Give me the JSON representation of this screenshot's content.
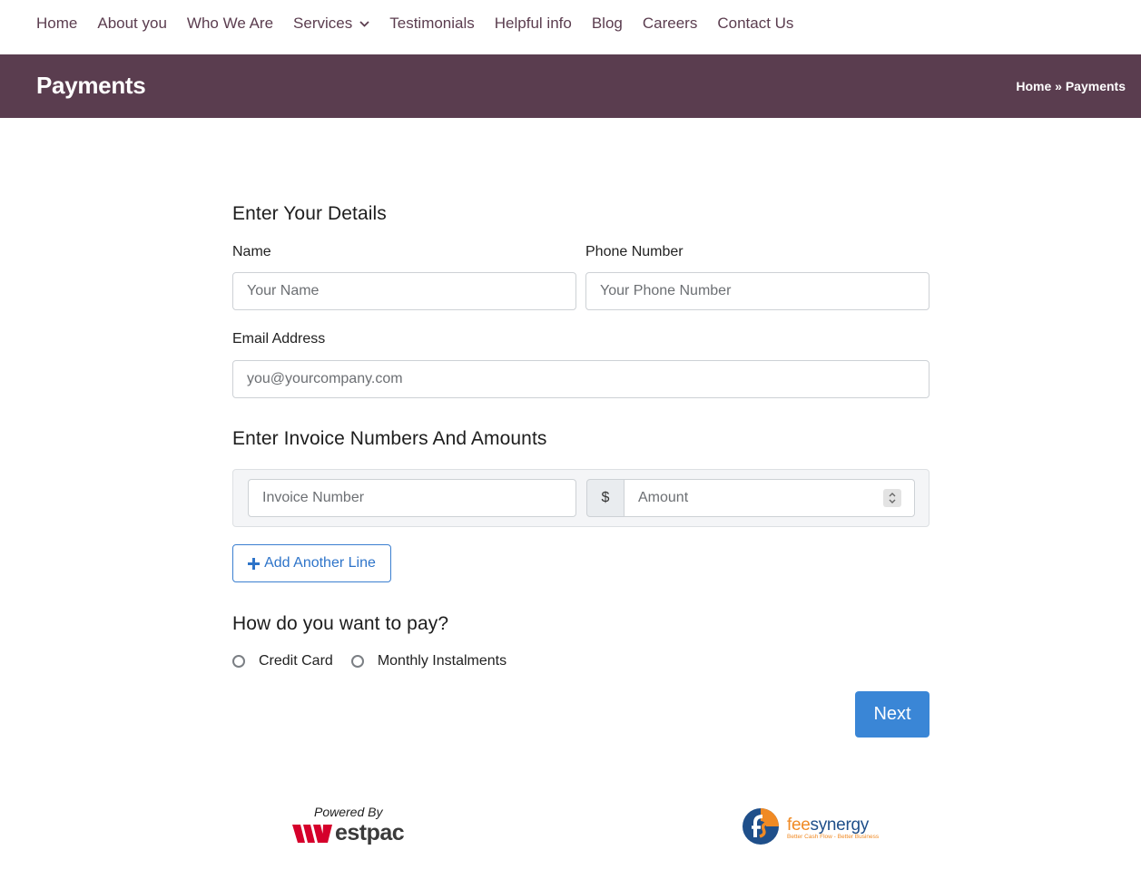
{
  "nav": {
    "items": [
      {
        "label": "Home"
      },
      {
        "label": "About you"
      },
      {
        "label": "Who We Are"
      },
      {
        "label": "Services"
      },
      {
        "label": "Testimonials"
      },
      {
        "label": "Helpful info"
      },
      {
        "label": "Blog"
      },
      {
        "label": "Careers"
      },
      {
        "label": "Contact Us"
      }
    ]
  },
  "header": {
    "title": "Payments",
    "breadcrumb": {
      "home": "Home",
      "separator": "»",
      "current": "Payments"
    },
    "background_color": "#5a3d4f"
  },
  "details": {
    "heading": "Enter Your Details",
    "name_label": "Name",
    "name_placeholder": "Your Name",
    "phone_label": "Phone Number",
    "phone_placeholder": "Your Phone Number",
    "email_label": "Email Address",
    "email_placeholder": "you@yourcompany.com"
  },
  "invoices": {
    "heading": "Enter Invoice Numbers And Amounts",
    "invoice_placeholder": "Invoice Number",
    "currency_symbol": "$",
    "amount_placeholder": "Amount",
    "add_line_label": "Add Another Line"
  },
  "payment": {
    "heading": "How do you want to pay?",
    "options": [
      {
        "label": "Credit Card",
        "selected": false
      },
      {
        "label": "Monthly Instalments",
        "selected": false
      }
    ],
    "next_label": "Next"
  },
  "footer": {
    "powered_by": "Powered By",
    "westpac_word": "estpac",
    "feesynergy_fee": "fee",
    "feesynergy_synergy": "synergy",
    "feesynergy_tagline": "Better Cash Flow - Better Business"
  },
  "colors": {
    "nav_text": "#5b3d4f",
    "primary_button": "#3a86d6",
    "outline_button": "#3b7fd0",
    "westpac_red": "#d5002b",
    "feesynergy_orange": "#f08a24",
    "feesynergy_blue": "#1f4f8a"
  }
}
